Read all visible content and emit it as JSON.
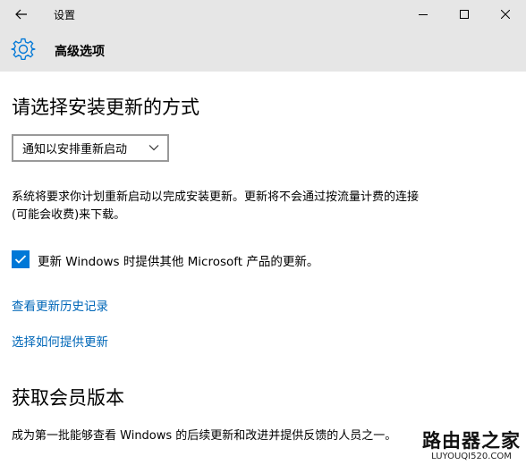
{
  "window": {
    "title": "设置",
    "controls": [
      "minimize",
      "maximize",
      "close"
    ]
  },
  "header": {
    "icon": "gear-icon",
    "title": "高级选项"
  },
  "install_section": {
    "heading": "请选择安装更新的方式",
    "dropdown_selected": "通知以安排重新启动",
    "description": "系统将要求你计划重新启动以完成安装更新。更新将不会通过按流量计费的连接(可能会收费)来下载。"
  },
  "checkbox": {
    "checked": true,
    "label": "更新 Windows 时提供其他 Microsoft 产品的更新。"
  },
  "links": {
    "history": "查看更新历史记录",
    "delivery": "选择如何提供更新"
  },
  "insider_section": {
    "heading": "获取会员版本",
    "description": "成为第一批能够查看 Windows 的后续更新和改进并提供反馈的人员之一。"
  },
  "watermark": {
    "main": "路由器之家",
    "sub": "LUYOUQI520.COM"
  },
  "colors": {
    "titlebar_bg": "#e6e6e6",
    "accent": "#0078d7",
    "link": "#0067b8"
  }
}
